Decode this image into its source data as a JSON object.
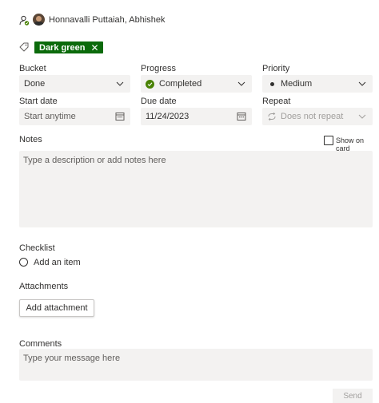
{
  "assignee": {
    "name": "Honnavalli Puttaiah, Abhishek"
  },
  "label_tag": {
    "text": "Dark green",
    "color": "#0b6a0b"
  },
  "fields": {
    "bucket": {
      "label": "Bucket",
      "value": "Done"
    },
    "progress": {
      "label": "Progress",
      "value": "Completed",
      "status_color": "#498205"
    },
    "priority": {
      "label": "Priority",
      "value": "Medium"
    },
    "start_date": {
      "label": "Start date",
      "placeholder": "Start anytime"
    },
    "due_date": {
      "label": "Due date",
      "value": "11/24/2023"
    },
    "repeat": {
      "label": "Repeat",
      "value": "Does not repeat"
    }
  },
  "notes": {
    "label": "Notes",
    "placeholder": "Type a description or add notes here",
    "show_on_card": "Show on card"
  },
  "checklist": {
    "label": "Checklist",
    "add_item": "Add an item"
  },
  "attachments": {
    "label": "Attachments",
    "button": "Add attachment"
  },
  "comments": {
    "label": "Comments",
    "placeholder": "Type your message here",
    "send": "Send"
  },
  "icons": [
    "assign-icon",
    "avatar",
    "tag-icon",
    "close-icon",
    "chevron-down-icon",
    "calendar-icon",
    "repeat-icon",
    "check-icon"
  ]
}
